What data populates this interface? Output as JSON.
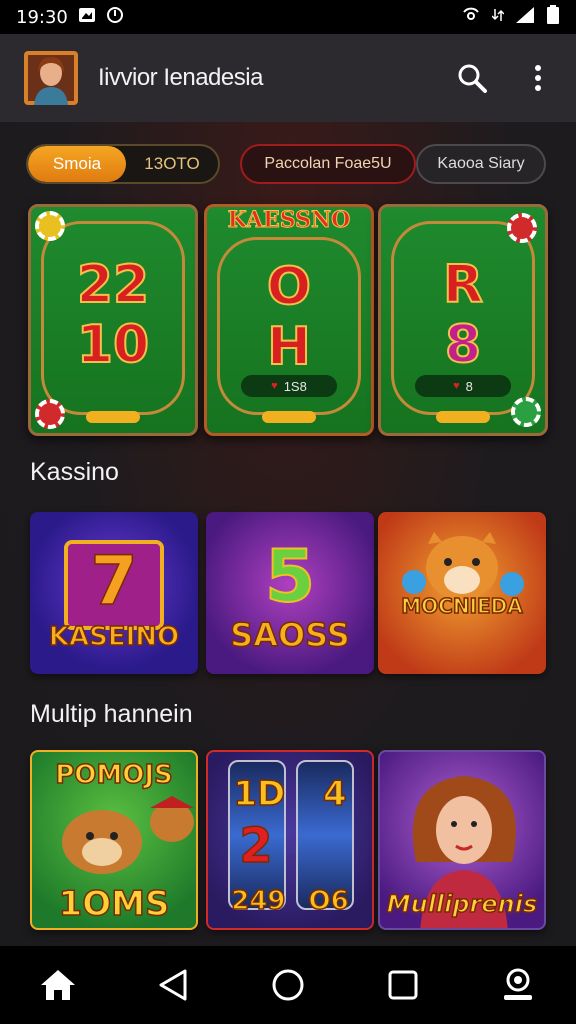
{
  "status": {
    "time": "19:30"
  },
  "app": {
    "title": "Iivvior Ienadesia"
  },
  "chips": [
    {
      "label": "Smoia",
      "active": true
    },
    {
      "label": "13OTO",
      "active": false
    },
    {
      "label": "Paccolan Foae5U",
      "active": false
    },
    {
      "label": "Kaooa Siary",
      "active": false
    }
  ],
  "tables": [
    {
      "top": "22",
      "bottom": "10",
      "pill": "",
      "banner": ""
    },
    {
      "top": "O",
      "bottom": "H",
      "pill": "1S8",
      "banner": "KAESSNO"
    },
    {
      "top": "R",
      "bottom": "8",
      "pill": "8",
      "banner": ""
    }
  ],
  "sections": {
    "casino": "Kassino",
    "multi": "Multip hannein"
  },
  "casino_games": [
    {
      "big": "7",
      "label": "KASEINO"
    },
    {
      "big": "5",
      "label": "SAOSS"
    },
    {
      "big": "",
      "label": "MOCNIEDA"
    }
  ],
  "multi_games": [
    {
      "top": "POMOJS",
      "label": "1OMS"
    },
    {
      "top": "1D 4",
      "mid": "2",
      "label": "249 O6"
    },
    {
      "top": "",
      "label": "Mulliprenis"
    }
  ],
  "colors": {
    "accent": "#f5a623",
    "background": "#1c1a1d",
    "felt": "#1f8a2e"
  }
}
